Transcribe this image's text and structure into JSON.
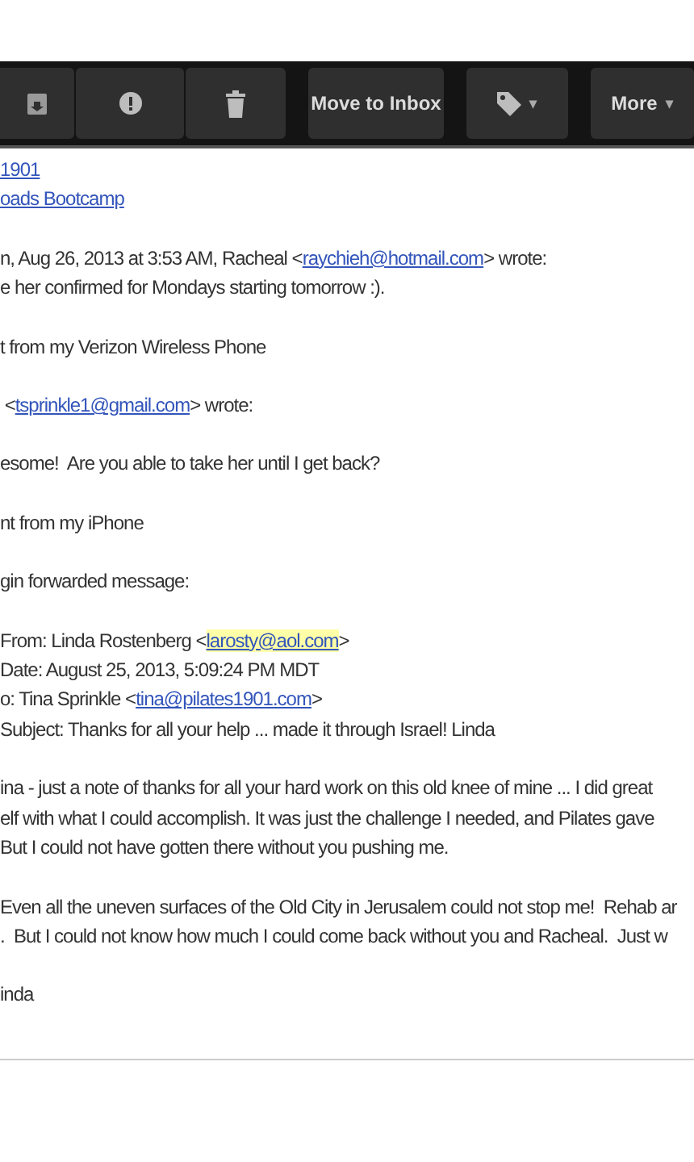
{
  "toolbar": {
    "buttons": [
      {
        "kind": "archive"
      },
      {
        "kind": "spam"
      },
      {
        "kind": "delete"
      },
      {
        "kind": "text",
        "label": "Move to Inbox"
      },
      {
        "kind": "labels",
        "caret": "▾"
      },
      {
        "kind": "text",
        "label": "More",
        "caret": "▾"
      }
    ]
  },
  "message": {
    "blocks": [
      {
        "lines": [
          {
            "link": "1901"
          },
          {
            "link": "oads Bootcamp"
          }
        ]
      },
      {
        "lines": [
          {
            "before": "n, Aug 26, 2013 at 3:53 AM, Racheal <",
            "link": "raychieh@hotmail.com",
            "after": "> wrote:"
          },
          {
            "before": "e her confirmed for Mondays starting tomorrow :)."
          }
        ]
      },
      {
        "lines": [
          {
            "before": "t from my Verizon Wireless Phone"
          }
        ]
      },
      {
        "lines": [
          {
            "before": " <",
            "link": "tsprinkle1@gmail.com",
            "after": "> wrote:"
          }
        ]
      },
      {
        "lines": [
          {
            "before": "esome!  Are you able to take her until I get back?"
          }
        ]
      },
      {
        "lines": [
          {
            "before": "nt from my iPhone"
          }
        ]
      },
      {
        "lines": [
          {
            "before": "gin forwarded message:"
          }
        ]
      },
      {
        "lines": [
          {
            "before": "From: Linda Rostenberg <",
            "link": "larosty@aol.com",
            "highlighted": true,
            "after": ">"
          },
          {
            "before": "Date: August 25, 2013, 5:09:24 PM MDT"
          },
          {
            "before": "o: Tina Sprinkle <",
            "link": "tina@pilates1901.com",
            "after": ">"
          },
          {
            "before": "Subject: Thanks for all your help ... made it through Israel! Linda"
          }
        ]
      },
      {
        "lines": [
          {
            "before": "ina - just a note of thanks for all your hard work on this old knee of mine ... I did great"
          },
          {
            "before": "elf with what I could accomplish. It was just the challenge I needed, and Pilates gave"
          },
          {
            "before": "But I could not have gotten there without you pushing me."
          }
        ]
      },
      {
        "lines": [
          {
            "before": "Even all the uneven surfaces of the Old City in Jerusalem could not stop me!  Rehab ar"
          },
          {
            "before": ".  But I could not know how much I could come back without you and Racheal.  Just w"
          }
        ]
      },
      {
        "lines": [
          {
            "before": "inda"
          }
        ]
      }
    ]
  }
}
